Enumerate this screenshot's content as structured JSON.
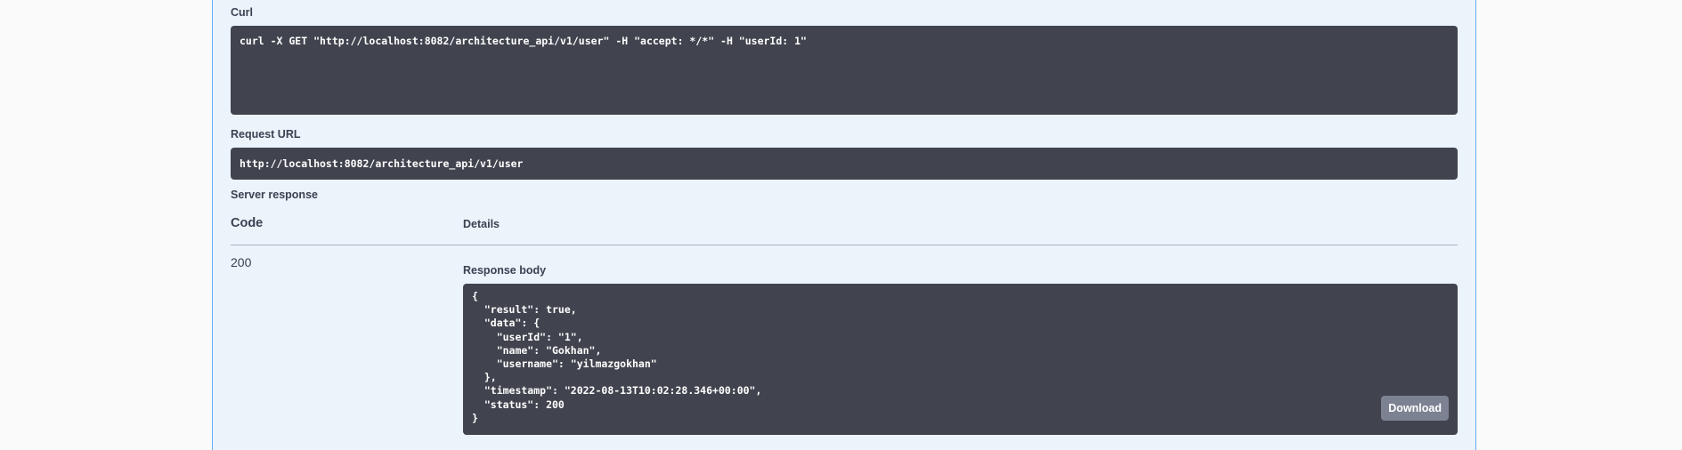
{
  "curl": {
    "label": "Curl",
    "command": "curl -X GET \"http://localhost:8082/architecture_api/v1/user\" -H \"accept: */*\" -H \"userId: 1\""
  },
  "request_url": {
    "label": "Request URL",
    "value": "http://localhost:8082/architecture_api/v1/user"
  },
  "server_response": {
    "label": "Server response",
    "columns": {
      "code": "Code",
      "details": "Details"
    },
    "status_code": "200",
    "response_body_label": "Response body",
    "response_body": "{\n  \"result\": true,\n  \"data\": {\n    \"userId\": \"1\",\n    \"name\": \"Gokhan\",\n    \"username\": \"yilmazgokhan\"\n  },\n  \"timestamp\": \"2022-08-13T10:02:28.346+00:00\",\n  \"status\": 200\n}",
    "download_label": "Download"
  },
  "colors": {
    "panel_bg": "#ebf3fb",
    "panel_border": "#61affe",
    "code_bg": "#41444e",
    "button_bg": "#7d8293",
    "text": "#3b4151"
  }
}
